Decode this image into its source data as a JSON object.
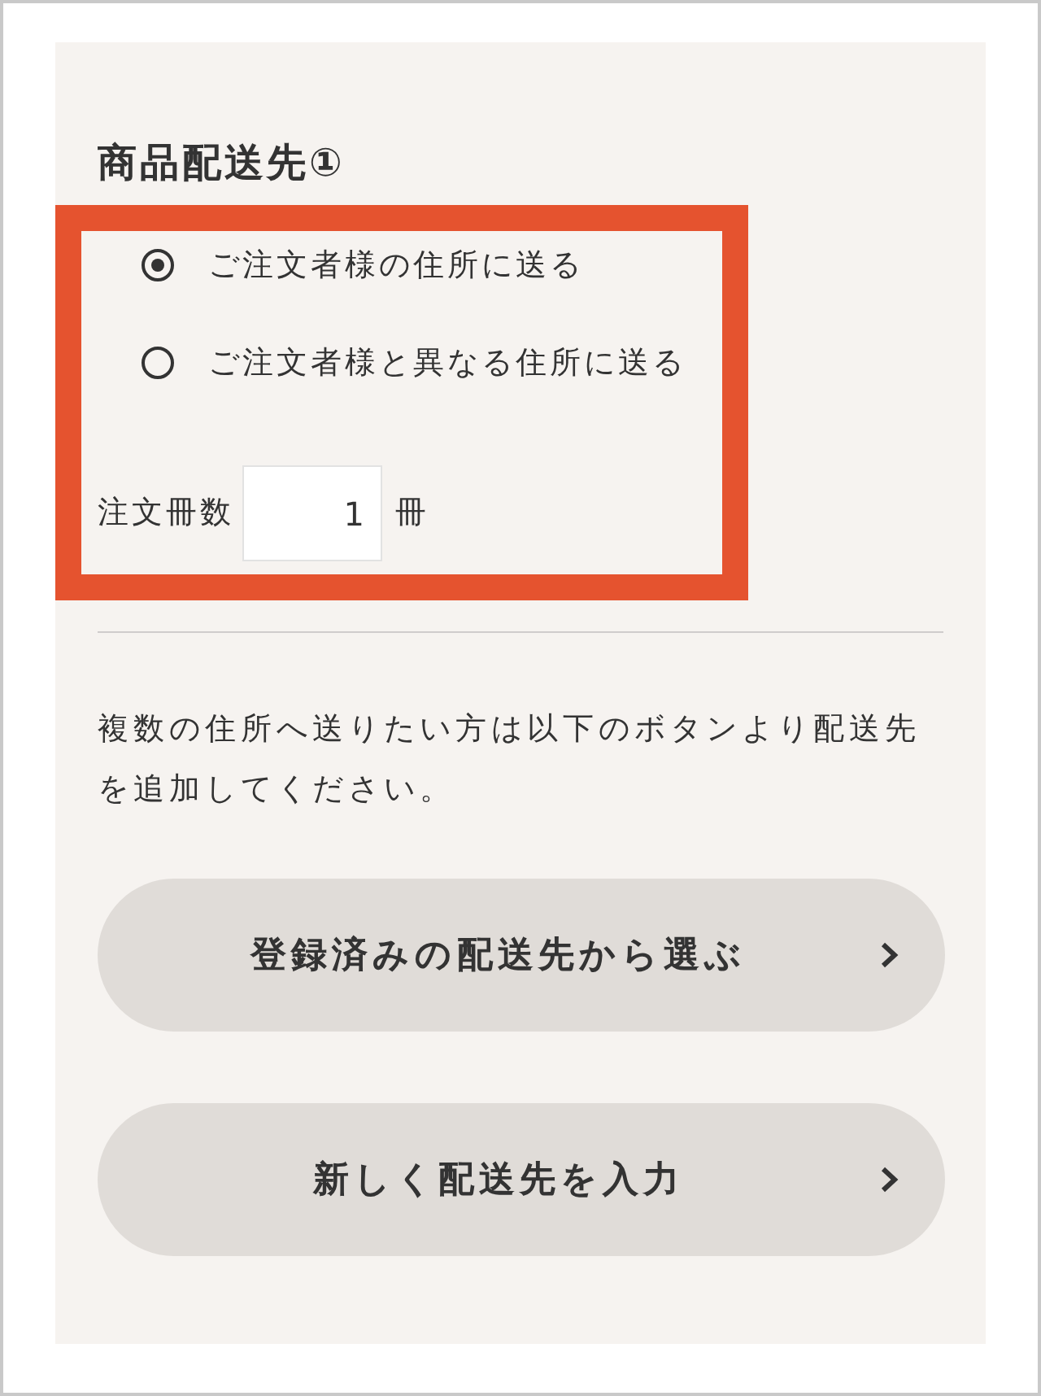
{
  "section": {
    "title": "商品配送先①",
    "highlighted": true,
    "options": [
      {
        "label": "ご注文者様の住所に送る",
        "selected": true
      },
      {
        "label": "ご注文者様と異なる住所に送る",
        "selected": false
      }
    ],
    "quantity": {
      "label": "注文冊数",
      "value": "1",
      "unit": "冊"
    }
  },
  "note": "複数の住所へ送りたい方は以下のボタンより配送先を追加してください。",
  "buttons": [
    {
      "label": "登録済みの配送先から選ぶ"
    },
    {
      "label": "新しく配送先を入力"
    }
  ]
}
